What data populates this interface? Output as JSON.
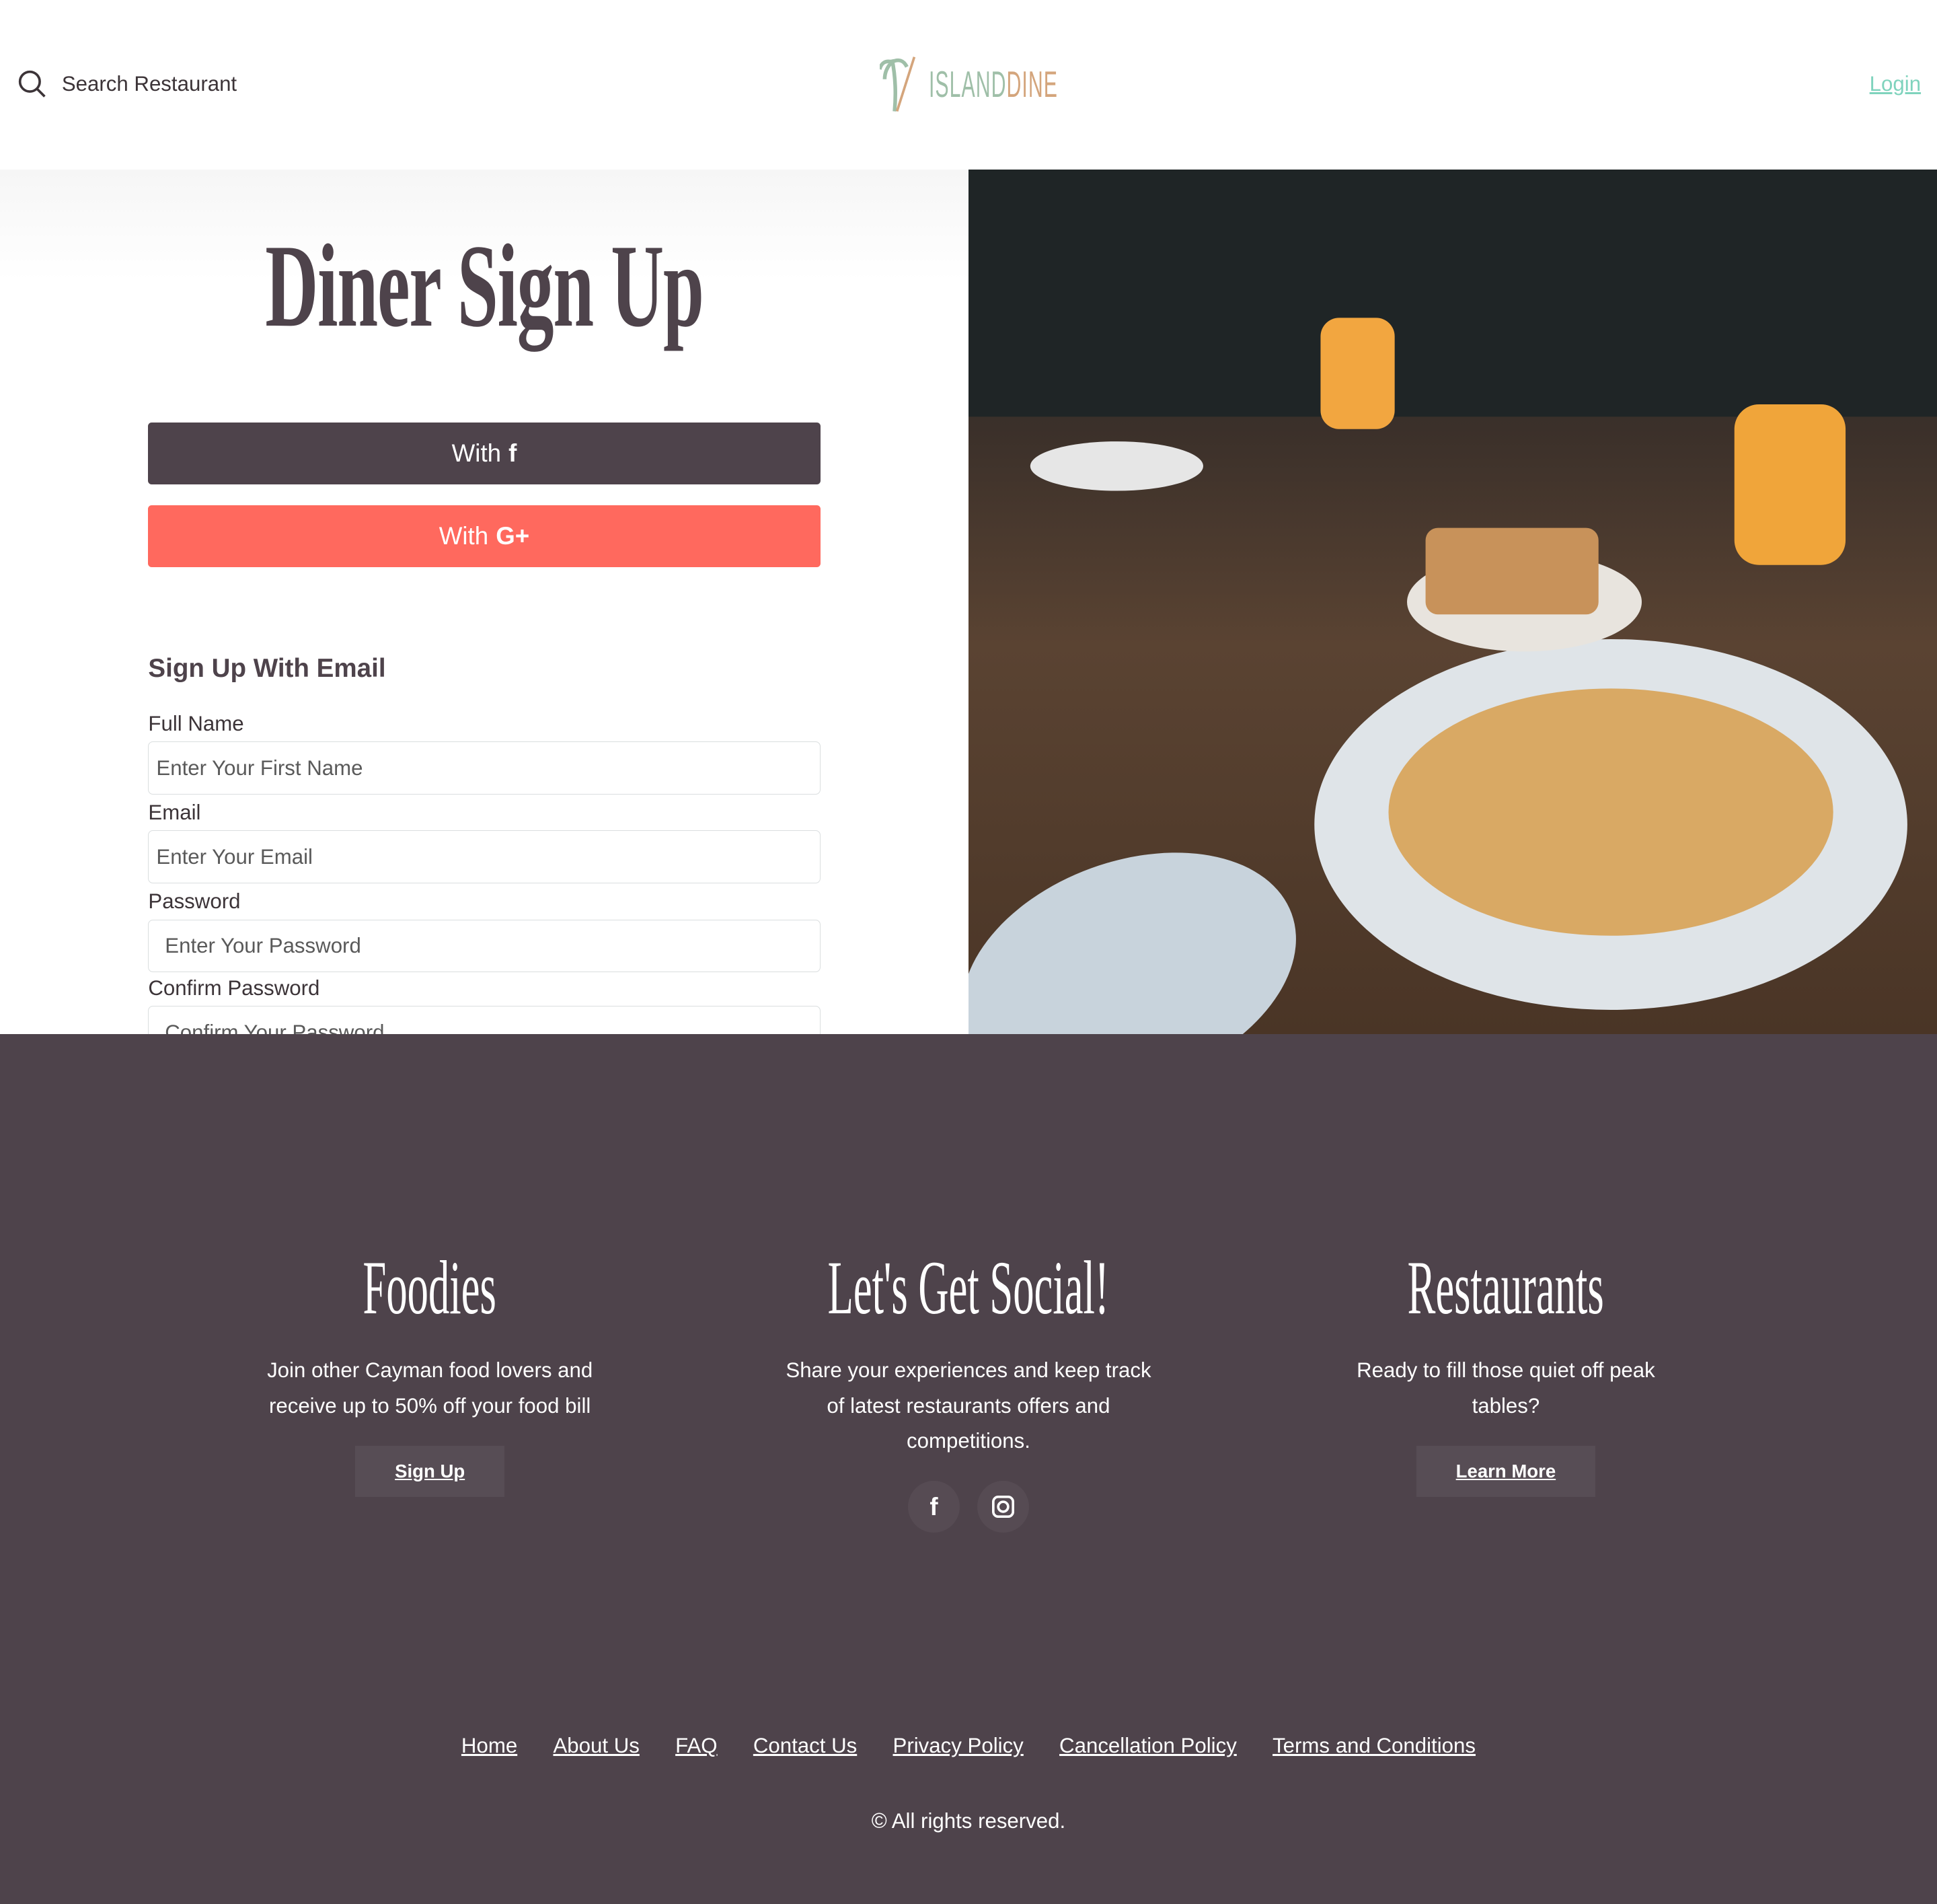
{
  "header": {
    "search_label": "Search Restaurant",
    "logo_text_a": "ISLAND",
    "logo_text_b": "DINE",
    "login": "Login"
  },
  "signup": {
    "title": "Diner Sign Up",
    "facebook_button": "With",
    "google_button": "With",
    "google_icon": "G+",
    "section_title": "Sign Up With Email",
    "fields": [
      {
        "label": "Full Name",
        "placeholder": "Enter Your First Name"
      },
      {
        "label": "Email",
        "placeholder": "Enter Your Email"
      },
      {
        "label": "Password",
        "placeholder": "Enter Your Password"
      },
      {
        "label": "Confirm Password",
        "placeholder": "Confirm Your Password"
      }
    ]
  },
  "footer": {
    "columns": [
      {
        "title": "Foodies",
        "text": "Join other Cayman food lovers and receive up to 50% off your food bill",
        "button": "Sign Up"
      },
      {
        "title": "Let's Get Social!",
        "text": "Share your experiences and keep track of latest restaurants offers and competitions."
      },
      {
        "title": "Restaurants",
        "text": "Ready to fill those quiet off peak tables?",
        "button": "Learn More"
      }
    ],
    "links": [
      "Home",
      "About Us",
      "FAQ",
      "Contact Us",
      "Privacy Policy",
      "Cancellation Policy",
      "Terms and Conditions"
    ],
    "copyright": "© All rights reserved."
  },
  "colors": {
    "brand": "#4e434b",
    "google": "#ff695e",
    "login": "#7fd3bd"
  }
}
